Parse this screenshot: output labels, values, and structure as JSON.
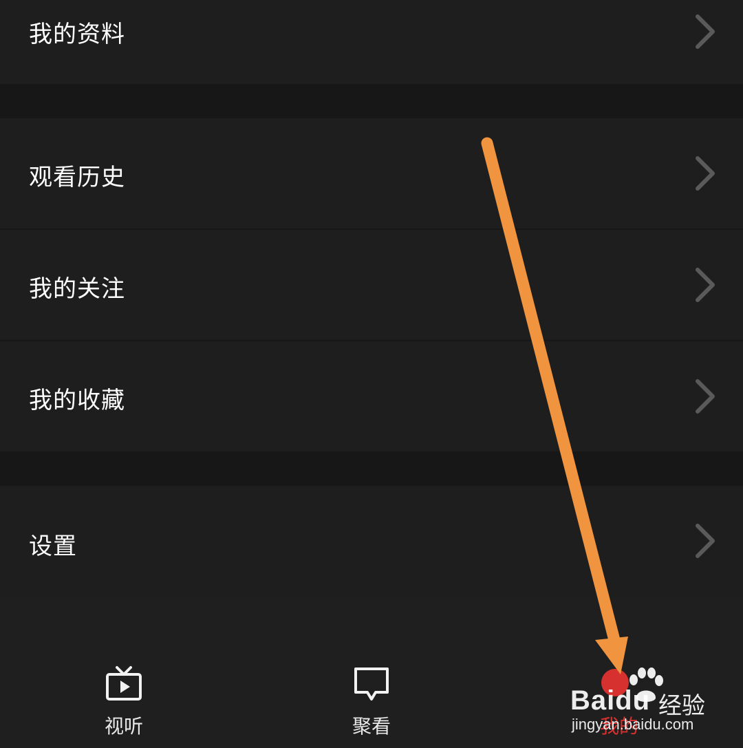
{
  "menu": {
    "profile_label": "我的资料",
    "history_label": "观看历史",
    "follow_label": "我的关注",
    "favorites_label": "我的收藏",
    "settings_label": "设置"
  },
  "tabbar": {
    "tabs": [
      {
        "label": "视听",
        "icon": "tv-icon",
        "active": false
      },
      {
        "label": "聚看",
        "icon": "chat-bubble-icon",
        "active": false
      },
      {
        "label": "我的",
        "icon": "profile-icon",
        "active": true
      }
    ]
  },
  "watermark": {
    "brand": "Baidu",
    "brand_cn": "经验",
    "url": "jingyan.baidu.com"
  },
  "colors": {
    "background": "#1d1d1d",
    "row": "#1e1e1e",
    "chevron": "#5a5a5a",
    "active_tab": "#d6312f",
    "annotation_arrow": "#f0943f"
  }
}
